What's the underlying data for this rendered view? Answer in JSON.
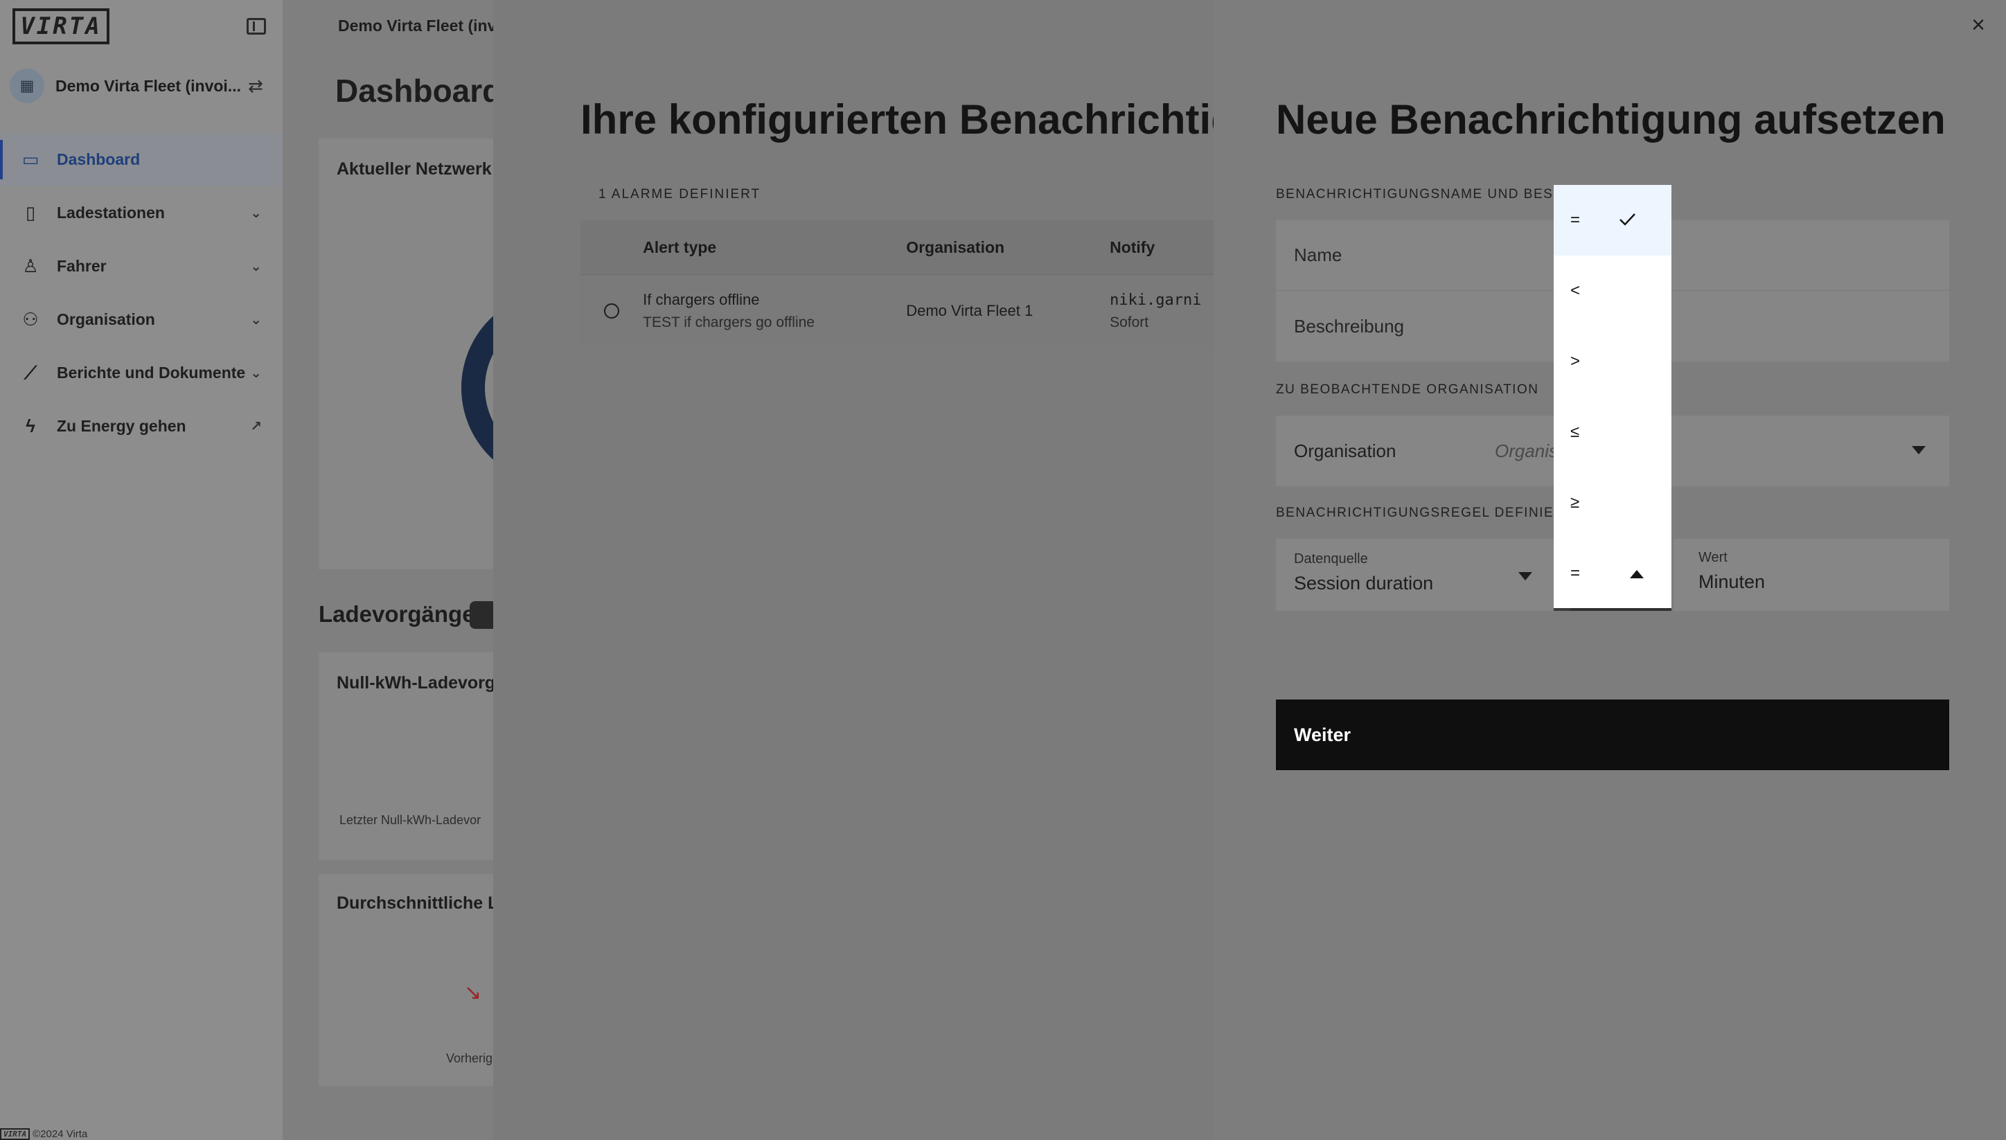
{
  "sidebar": {
    "logo": "VIRTA",
    "org_name": "Demo Virta Fleet (invoi...",
    "items": [
      {
        "label": "Dashboard",
        "icon": "dashboard-icon"
      },
      {
        "label": "Ladestationen",
        "icon": "charger-icon"
      },
      {
        "label": "Fahrer",
        "icon": "driver-icon"
      },
      {
        "label": "Organisation",
        "icon": "organisation-icon"
      },
      {
        "label": "Berichte und Dokumente",
        "icon": "chart-icon"
      },
      {
        "label": "Zu Energy gehen",
        "icon": "lightning-icon"
      }
    ],
    "footer": "©2024 Virta",
    "footer_logo": "VIRTA"
  },
  "main": {
    "breadcrumb": "Demo Virta Fleet (inv",
    "title": "Dashboard",
    "card1_title": "Aktueller Netzwerk",
    "section_title": "Ladevorgänge",
    "card2_title": "Null-kWh-Ladevorg",
    "card2_note": "Letzter Null-kWh-Ladevor",
    "card3_title": "Durchschnittliche L",
    "card3_note": "Vorherig"
  },
  "alerts_panel": {
    "title": "Ihre konfigurierten Benachrichtigungen",
    "count_label": "1 ALARME DEFINIERT",
    "columns": [
      "Alert type",
      "Organisation",
      "Notify"
    ],
    "rows": [
      {
        "type": "If chargers offline",
        "description": "TEST if chargers go offline",
        "organisation": "Demo Virta Fleet 1",
        "notify": "niki.garni",
        "frequency": "Sofort"
      }
    ]
  },
  "new_alert": {
    "title": "Neue Benachrichtigung aufsetzen",
    "section_name": "BENACHRICHTIGUNGSNAME UND BESCHREIBUNG",
    "name_placeholder": "Name",
    "description_placeholder": "Beschreibung",
    "section_org": "ZU BEOBACHTENDE ORGANISATION",
    "org_label": "Organisation",
    "org_placeholder": "Organisation",
    "section_rule": "BENACHRICHTIGUNGSREGEL DEFINIEREN",
    "datasource_label": "Datenquelle",
    "datasource_value": "Session duration",
    "value_label": "Wert",
    "value_placeholder": "Minuten",
    "submit_label": "Weiter"
  },
  "operator_dropdown": {
    "options": [
      "=",
      "<",
      ">",
      "≤",
      "≥"
    ],
    "selected": "="
  }
}
